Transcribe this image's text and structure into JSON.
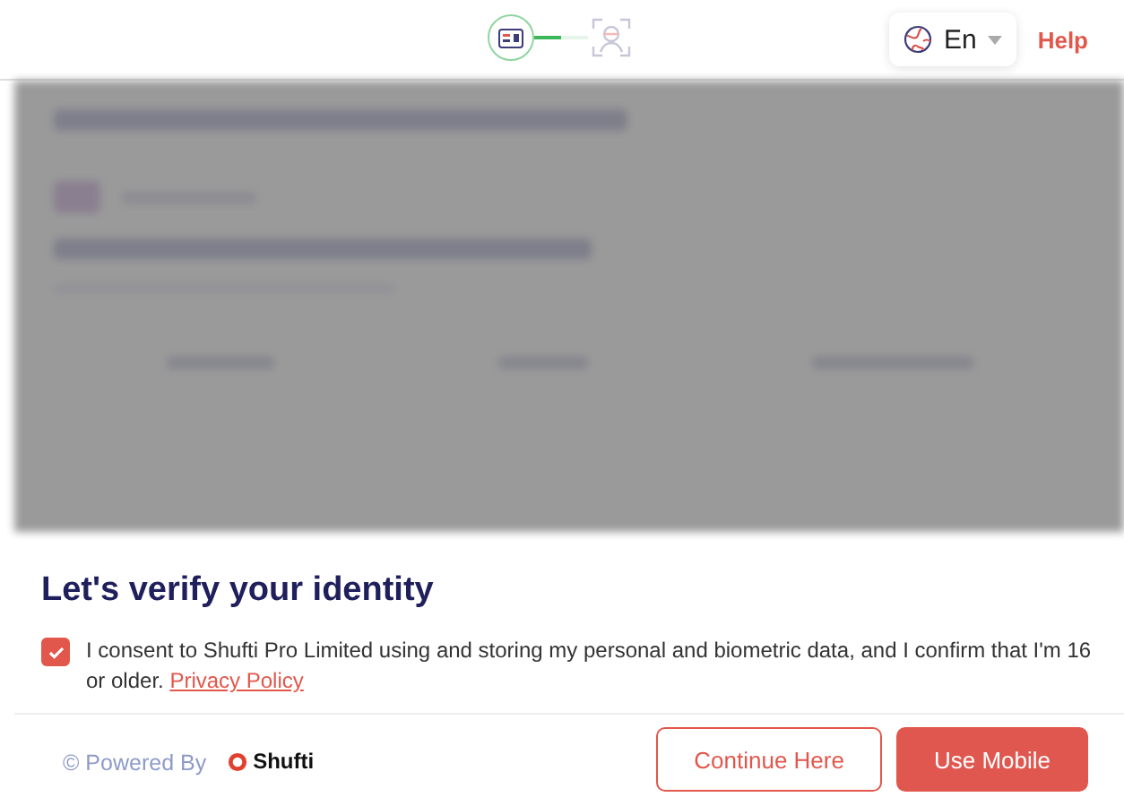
{
  "header": {
    "steps": [
      {
        "kind": "document",
        "selected": true
      },
      {
        "kind": "face",
        "selected": false
      }
    ],
    "language": {
      "label": "En"
    },
    "help": "Help"
  },
  "modal": {
    "title": "Let's verify your identity",
    "consent": {
      "checked": true,
      "text": "I consent to Shufti Pro Limited using and storing my personal and biometric data, and I confirm that I'm 16 or older.",
      "link": "Privacy Policy"
    },
    "powered_by": "© Powered By",
    "brand": "Shufti",
    "buttons": [
      {
        "label": "Continue Here",
        "kind": "secondary"
      },
      {
        "label": "Use Mobile",
        "kind": "primary"
      }
    ]
  }
}
